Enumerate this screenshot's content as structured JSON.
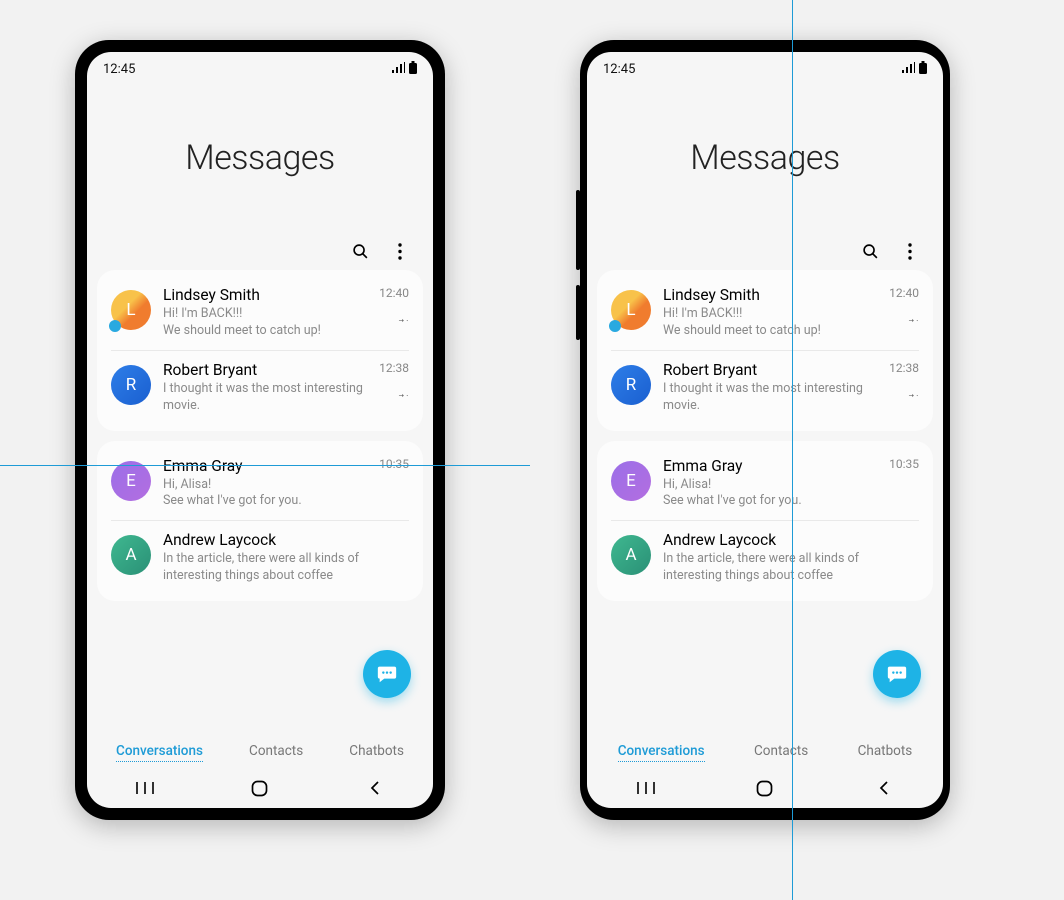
{
  "status": {
    "time": "12:45"
  },
  "header": {
    "title": "Messages"
  },
  "tabs": {
    "conversations": "Conversations",
    "contacts": "Contacts",
    "chatbots": "Chatbots"
  },
  "cards": [
    {
      "items": [
        {
          "initial": "L",
          "name": "Lindsey Smith",
          "preview": "Hi! I'm BACK!!!\nWe should meet to catch up!",
          "time": "12:40",
          "pinned": true
        },
        {
          "initial": "R",
          "name": "Robert Bryant",
          "preview": "I thought it was the most interesting movie.",
          "time": "12:38",
          "pinned": true
        }
      ]
    },
    {
      "items": [
        {
          "initial": "E",
          "name": "Emma Gray",
          "preview": "Hi, Alisa!\nSee what I've got for you.",
          "time": "10:35",
          "pinned": false
        },
        {
          "initial": "A",
          "name": "Andrew Laycock",
          "preview": "In the article, there were all kinds of interesting things about coffee",
          "time": "",
          "pinned": false
        }
      ]
    }
  ]
}
